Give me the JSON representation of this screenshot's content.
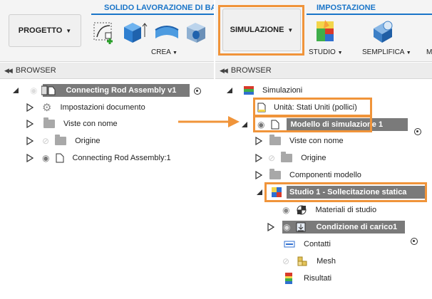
{
  "left": {
    "tab_title": "SOLIDO LAVORAZIONE DI BASE",
    "workspace_button": "PROGETTO",
    "group_label": "CREA",
    "browser_title": "BROWSER",
    "tree": {
      "root": "Connecting Rod Assembly v1",
      "items": [
        "Impostazioni documento",
        "Viste con nome",
        "Origine",
        "Connecting Rod Assembly:1"
      ]
    }
  },
  "right": {
    "tab_title": "IMPOSTAZIONE",
    "workspace_button": "SIMULAZIONE",
    "groups": [
      "STUDIO",
      "SEMPLIFICA",
      "M"
    ],
    "browser_title": "BROWSER",
    "tree": {
      "root": "Simulazioni",
      "units": "Unità: Stati Uniti (pollici)",
      "model": "Modello di simulazione 1",
      "model_items": [
        "Viste con nome",
        "Origine",
        "Componenti modello"
      ],
      "study": "Studio 1 - Sollecitazione statica",
      "study_items": [
        "Materiali di studio",
        "Condizione di carico1",
        "Contatti",
        "Mesh",
        "Risultati"
      ]
    }
  },
  "colors": {
    "accent": "#1a75c8",
    "highlight": "#f0943a",
    "selected_bar": "#7a7a7a"
  }
}
